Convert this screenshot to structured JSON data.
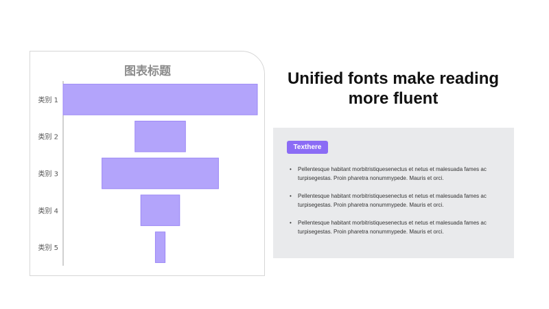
{
  "chart_data": {
    "type": "bar",
    "subtype": "funnel",
    "title": "图表标题",
    "categories": [
      "类别 1",
      "类别 2",
      "类别 3",
      "类别 4",
      "类别 5"
    ],
    "values": [
      100,
      26,
      60,
      20,
      5
    ],
    "grid": false,
    "legend": "none",
    "bar_color": "#b3a4fb",
    "bar_edge_color": "#9b87f5"
  },
  "headline": "Unified fonts make reading more fluent",
  "panel": {
    "tag_label": "Texthere",
    "bullet_glyph": "•",
    "bullets": [
      "Pellentesque habitant morbitristiquesenectus et netus et malesuada fames ac turpisegestas. Proin pharetra nonummypede. Mauris et orci.",
      "Pellentesque habitant morbitristiquesenectus et netus et malesuada fames ac turpisegestas. Proin pharetra nonummypede. Mauris et orci.",
      "Pellentesque habitant morbitristiquesenectus et netus et malesuada fames ac turpisegestas. Proin pharetra nonummypede. Mauris et orci."
    ]
  },
  "colors": {
    "accent": "#8b6cf5",
    "panel_bg": "#e9eaec",
    "title_gray": "#8c8c8c"
  }
}
